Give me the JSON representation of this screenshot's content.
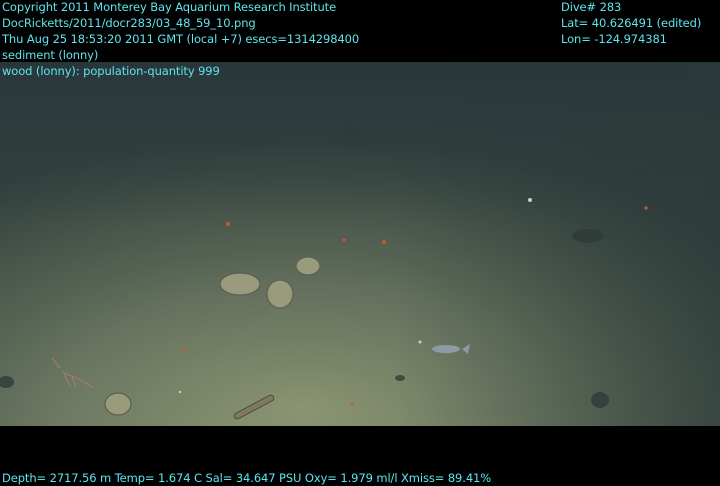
{
  "overlay": {
    "text_color": "#5ee6ee",
    "left_lines": [
      "Copyright 2011 Monterey Bay Aquarium Research Institute",
      "DocRicketts/2011/docr283/03_48_59_10.png",
      "Thu Aug 25 18:53:20 2011 GMT (local +7)  esecs=1314298400",
      "sediment (lonny)",
      "wood (lonny): population-quantity 999"
    ],
    "right_lines": [
      "Dive# 283",
      "Lat= 40.626491 (edited)",
      "Lon= -124.974381"
    ],
    "bottom_line": "Depth= 2717.56 m  Temp= 1.674 C  Sal= 34.647 PSU  Oxy= 1.979 ml/l  Xmiss= 89.41%"
  },
  "scene": {
    "description_colors": {
      "letterbox": "#000000",
      "sediment_light": "#8a9470",
      "sediment_dark": "#2c3a3a"
    }
  }
}
